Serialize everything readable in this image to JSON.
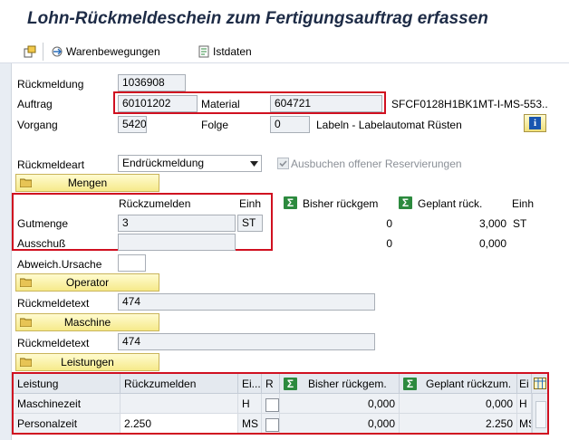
{
  "window": {
    "title": "Lohn-Rückmeldeschein zum Fertigungsauftrag erfassen"
  },
  "toolbar": {
    "warenbewegungen": "Warenbewegungen",
    "istdaten": "Istdaten"
  },
  "header": {
    "rueckmeldung_label": "Rückmeldung",
    "rueckmeldung_value": "1036908",
    "auftrag_label": "Auftrag",
    "auftrag_value": "60101202",
    "material_label": "Material",
    "material_value": "604721",
    "material_desc": "SFCF0128H1BK1MT-I-MS-553...",
    "vorgang_label": "Vorgang",
    "vorgang_value": "5420",
    "folge_label": "Folge",
    "folge_value": "0",
    "folge_desc": "Labeln - Labelautomat Rüsten"
  },
  "rueckmeldeart": {
    "label": "Rückmeldeart",
    "value": "Endrückmeldung",
    "ausbuchen_label": "Ausbuchen offener Reservierungen",
    "ausbuchen_checked": true
  },
  "mengen": {
    "section_label": "Mengen",
    "col_rueck": "Rückzumelden",
    "col_einh": "Einh",
    "col_bisher": "Bisher rückgem",
    "col_geplant": "Geplant rück.",
    "col_einh2": "Einh",
    "gut_label": "Gutmenge",
    "gut_value": "3",
    "gut_unit": "ST",
    "gut_bisher": "0",
    "gut_geplant": "3,000",
    "gut_unit2": "ST",
    "aus_label": "Ausschuß",
    "aus_value": "",
    "aus_bisher": "0",
    "aus_geplant": "0,000"
  },
  "abweich": {
    "label": "Abweich.Ursache",
    "value": ""
  },
  "operator": {
    "section_label": "Operator",
    "text_label": "Rückmeldetext",
    "text_value": "474"
  },
  "maschine": {
    "section_label": "Maschine",
    "text_label": "Rückmeldetext",
    "text_value": "474"
  },
  "leistungen": {
    "section_label": "Leistungen",
    "headers": {
      "leistung": "Leistung",
      "rueck": "Rückzumelden",
      "einh": "Ei...",
      "r": "R",
      "bisher": "Bisher rückgem.",
      "geplant": "Geplant rückzum.",
      "einh2": "Ei"
    },
    "rows": [
      {
        "leistung": "Maschinezeit",
        "rueck": "",
        "einh": "H",
        "bisher": "0,000",
        "geplant": "0,000",
        "einh2": "H"
      },
      {
        "leistung": "Personalzeit",
        "rueck": "2.250",
        "einh": "MS",
        "bisher": "0,000",
        "geplant": "2.250",
        "einh2": "MS"
      }
    ]
  },
  "colors": {
    "accent": "#d01020",
    "section": "#f6ea8a",
    "readonly": "#eef1f5"
  }
}
